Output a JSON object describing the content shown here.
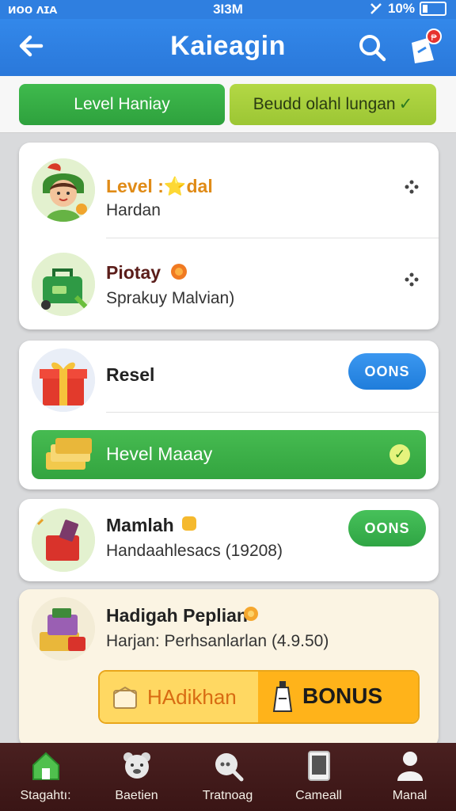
{
  "status_bar": {
    "left": "ᴎᴏᴏ ᴧɪᴀ",
    "center": "3I3M",
    "right": "10%"
  },
  "header": {
    "title": "Kaieagin",
    "notification_badge": "₱"
  },
  "tabs": [
    {
      "label": "Level Haniay"
    },
    {
      "label": "Beudd olahl lungan",
      "check": "✓"
    }
  ],
  "card_a": {
    "rows": [
      {
        "title": "Level :⭐dal",
        "subtitle": "Hardan"
      },
      {
        "title": "Piotay",
        "subtitle": "Sprakuy Malvian)"
      }
    ]
  },
  "card_b": {
    "title": "Resel",
    "button": "OONS",
    "bar_label": "Hevel Maaay",
    "bar_check": "✓"
  },
  "card_c": {
    "title": "Mamlah",
    "subtitle": "Handaahlesacs (19208)",
    "button": "OONS"
  },
  "card_d": {
    "title": "Hadigah Peplian",
    "subtitle": "Harjan: Perhsanlarlan  (4.9.50)",
    "left_button": "HAdikhan",
    "right_button": "BONUS"
  },
  "bottom_nav": [
    {
      "label": "Stagahtı:",
      "icon": "home-icon"
    },
    {
      "label": "Baetien",
      "icon": "bear-icon"
    },
    {
      "label": "Tratnoag",
      "icon": "chat-search-icon"
    },
    {
      "label": "Cameall",
      "icon": "tablet-icon"
    },
    {
      "label": "Manal",
      "icon": "person-icon"
    }
  ],
  "colors": {
    "primary": "#2f7fe0",
    "green": "#3fb34c",
    "nav": "#3f1a1a",
    "orange": "#ffb31a"
  }
}
